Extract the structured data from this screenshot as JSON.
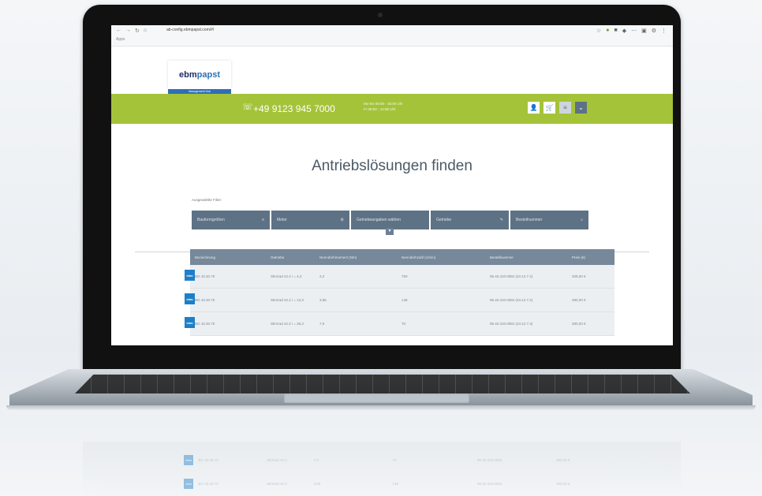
{
  "browser": {
    "url": "ab-config.ebmpapst.com/#/",
    "bookmark": "Apps",
    "nav": [
      "←",
      "→",
      "↻",
      "⌂"
    ],
    "extension_icons": [
      "☆",
      "●",
      "■",
      "◆",
      "⋯",
      "▣",
      "⚙",
      "⋮"
    ]
  },
  "header": {
    "logo_main": "ebm",
    "logo_accent": "papst",
    "logo_sub": "Management Hub",
    "phone_icon": "phone-icon",
    "phone": "+49 9123 945 7000",
    "hours_line1": "Mo-Do 08:00 - 16:00 Uhr",
    "hours_line2": "Fr 08:00 - 12:00 Uhr",
    "actions": [
      "user-icon",
      "cart-icon",
      "menu-icon",
      "chevron-down-icon"
    ]
  },
  "main": {
    "title": "Antriebslösungen finden",
    "filter_caption": "Ausgewählte Filter:",
    "filters": [
      {
        "label": "Bauformgrößen",
        "icon": "≡"
      },
      {
        "label": "Motor",
        "icon": "⚙"
      },
      {
        "label": "Getriebeangaben wählen",
        "icon": ""
      },
      {
        "label": "Getriebe",
        "icon": "✎"
      },
      {
        "label": "Bestellnummer",
        "icon": "⌕"
      }
    ],
    "table": {
      "headers": [
        "Bezeichnung",
        "Getriebe",
        "Nenndrehmoment (Nm)",
        "Nenndrehzahl (1/min)",
        "Bestellnummer",
        "Preis (€)"
      ],
      "rows": [
        {
          "thumb": "ebm",
          "name": "BG 43.30.70",
          "gear": "Stirnrad 42.2 i = 4,3",
          "torque": "2,2",
          "speed": "750",
          "order": "95.40.310.0084 (43.12.7.4)",
          "price": "209,00 €"
        },
        {
          "thumb": "ebm",
          "name": "BG 43.30.70",
          "gear": "Stirnrad 42.2 i = 13,3",
          "torque": "3,95",
          "speed": "148",
          "order": "95.40.310.0084 (43.12.7.2)",
          "price": "280,00 €"
        },
        {
          "thumb": "ebm",
          "name": "BG 43.30.70",
          "gear": "Stirnrad 42.2 i = 26,3",
          "torque": "7,5",
          "speed": "70",
          "order": "95.40.310.0084 (43.12.7.3)",
          "price": "280,00 €"
        }
      ]
    }
  },
  "reflection": {
    "rows": [
      {
        "name": "BG 43.30.70",
        "gear": "Stirnrad 42.2",
        "torque": "7,5",
        "speed": "70",
        "order": "95.40.310.0084",
        "price": "280,00 €"
      },
      {
        "name": "BG 43.30.70",
        "gear": "Stirnrad 42.2",
        "torque": "3,95",
        "speed": "148",
        "order": "95.40.310.0084",
        "price": "280,00 €"
      }
    ]
  }
}
